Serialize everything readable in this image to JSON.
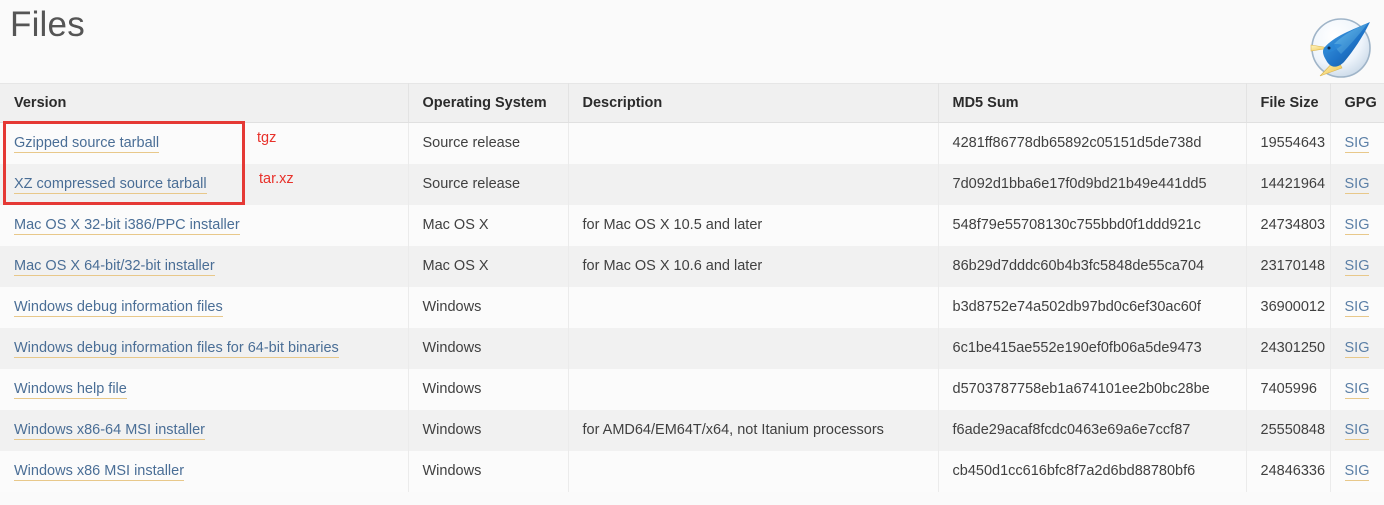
{
  "page": {
    "title": "Files",
    "logo_icon": "blue-bird-logo-icon"
  },
  "colors": {
    "accent_link": "#4a6e96",
    "link_underline": "#e8c88a",
    "annotation_red": "#e53935",
    "page_background": "#fafafa",
    "header_background": "#f0f0f0",
    "row_odd": "#fbfbfb",
    "row_even": "#f1f1f1"
  },
  "table": {
    "headers": {
      "version": "Version",
      "os": "Operating System",
      "description": "Description",
      "md5": "MD5 Sum",
      "size": "File Size",
      "gpg": "GPG"
    },
    "rows": [
      {
        "version": "Gzipped source tarball",
        "os": "Source release",
        "description": "",
        "md5": "4281ff86778db65892c05151d5de738d",
        "size": "19554643",
        "gpg": "SIG"
      },
      {
        "version": "XZ compressed source tarball",
        "os": "Source release",
        "description": "",
        "md5": "7d092d1bba6e17f0d9bd21b49e441dd5",
        "size": "14421964",
        "gpg": "SIG"
      },
      {
        "version": "Mac OS X 32-bit i386/PPC installer",
        "os": "Mac OS X",
        "description": "for Mac OS X 10.5 and later",
        "md5": "548f79e55708130c755bbd0f1ddd921c",
        "size": "24734803",
        "gpg": "SIG"
      },
      {
        "version": "Mac OS X 64-bit/32-bit installer",
        "os": "Mac OS X",
        "description": "for Mac OS X 10.6 and later",
        "md5": "86b29d7dddc60b4b3fc5848de55ca704",
        "size": "23170148",
        "gpg": "SIG"
      },
      {
        "version": "Windows debug information files",
        "os": "Windows",
        "description": "",
        "md5": "b3d8752e74a502db97bd0c6ef30ac60f",
        "size": "36900012",
        "gpg": "SIG"
      },
      {
        "version": "Windows debug information files for 64-bit binaries",
        "os": "Windows",
        "description": "",
        "md5": "6c1be415ae552e190ef0fb06a5de9473",
        "size": "24301250",
        "gpg": "SIG"
      },
      {
        "version": "Windows help file",
        "os": "Windows",
        "description": "",
        "md5": "d5703787758eb1a674101ee2b0bc28be",
        "size": "7405996",
        "gpg": "SIG"
      },
      {
        "version": "Windows x86-64 MSI installer",
        "os": "Windows",
        "description": "for AMD64/EM64T/x64, not Itanium processors",
        "md5": "f6ade29acaf8fcdc0463e69a6e7ccf87",
        "size": "25550848",
        "gpg": "SIG"
      },
      {
        "version": "Windows x86 MSI installer",
        "os": "Windows",
        "description": "",
        "md5": "cb450d1cc616bfc8f7a2d6bd88780bf6",
        "size": "24846336",
        "gpg": "SIG"
      }
    ]
  },
  "annotations": {
    "highlight_label": "source-tarball-rows-highlight",
    "tgz": "tgz",
    "tarxz": "tar.xz"
  }
}
